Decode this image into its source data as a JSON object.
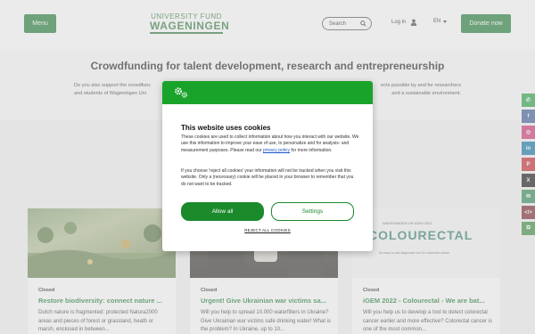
{
  "header": {
    "menu_label": "Menu",
    "logo_top": "UNIVERSITY FUND",
    "logo_bottom": "WAGENINGEN",
    "search_label": "Search",
    "login_label": "Log in",
    "language": "EN",
    "donate_label": "Donate now"
  },
  "hero": {
    "title": "Crowdfunding for talent development, research and entrepreneurship",
    "text_left": "Do you also support the crowdfunc",
    "text_right": "ects possible by and for researchers",
    "text_left2": "and students of Wageningen Uni",
    "text_right2": "and a sustainable environment."
  },
  "cards": [
    {
      "status": "Closed",
      "title": "Restore biodiversity: connect nature ...",
      "text": "Dutch nature is fragmented: protected Natura2000 areas and pieces of forest or grassland, heath or marsh, enclosed in between..."
    },
    {
      "status": "Closed",
      "title": "Urgent! Give Ukrainian war victims sa...",
      "text": "Will you help to spread 10.000 waterfilters in Ukraine? Give Ukrainian war victims safe drinking water! What is the problem? In Ukraine, up to 10..."
    },
    {
      "status": "Closed",
      "title": "iGEM 2022 - Colourectal - We are bat...",
      "text": "Will you help us to develop a tool to detect colorectal cancer earlier and more effective? Colorectal cancer is one of the most common...",
      "image_head": "WAGENINGEN UR  iGEM 2022",
      "image_logo": "COLOURECTAL",
      "image_sub": "An easy-to-use diagnostic tool for colorectal cancer"
    }
  ],
  "cookie_modal": {
    "title": "This website uses cookies",
    "p1_text": "These cookies are used to collect information about how you interact with our website. We use this information to improve your ease of use, to personalize and for analysis- and measurement purposes. Please read our ",
    "privacy_link": "privacy policy",
    "p1_end": " for more information.",
    "p2_text": "If you choose 'reject all cookies' your information will not be tracked when you visit this website. Only a (necessary) cookie will be placed in your browser to remember that you do not want to be tracked.",
    "allow_label": "Allow all",
    "settings_label": "Settings",
    "reject_label": "REJECT ALL COOKIES"
  },
  "social": [
    {
      "icon": "whatsapp-icon",
      "glyph": "✆",
      "color": "#25a244"
    },
    {
      "icon": "facebook-icon",
      "glyph": "f",
      "color": "#3b5998"
    },
    {
      "icon": "instagram-icon",
      "glyph": "◎",
      "color": "#d0326e"
    },
    {
      "icon": "linkedin-icon",
      "glyph": "in",
      "color": "#0e76a8"
    },
    {
      "icon": "pinterest-icon",
      "glyph": "P",
      "color": "#c8232c"
    },
    {
      "icon": "x-icon",
      "glyph": "X",
      "color": "#111111"
    },
    {
      "icon": "email-icon",
      "glyph": "✉",
      "color": "#2e8b57"
    },
    {
      "icon": "code-icon",
      "glyph": "</>",
      "color": "#7a1f2b"
    },
    {
      "icon": "copy-link-icon",
      "glyph": "⧉",
      "color": "#3a8a3a"
    }
  ],
  "colors": {
    "brand_green": "#1d7a33",
    "modal_bar": "#1aa32b"
  }
}
